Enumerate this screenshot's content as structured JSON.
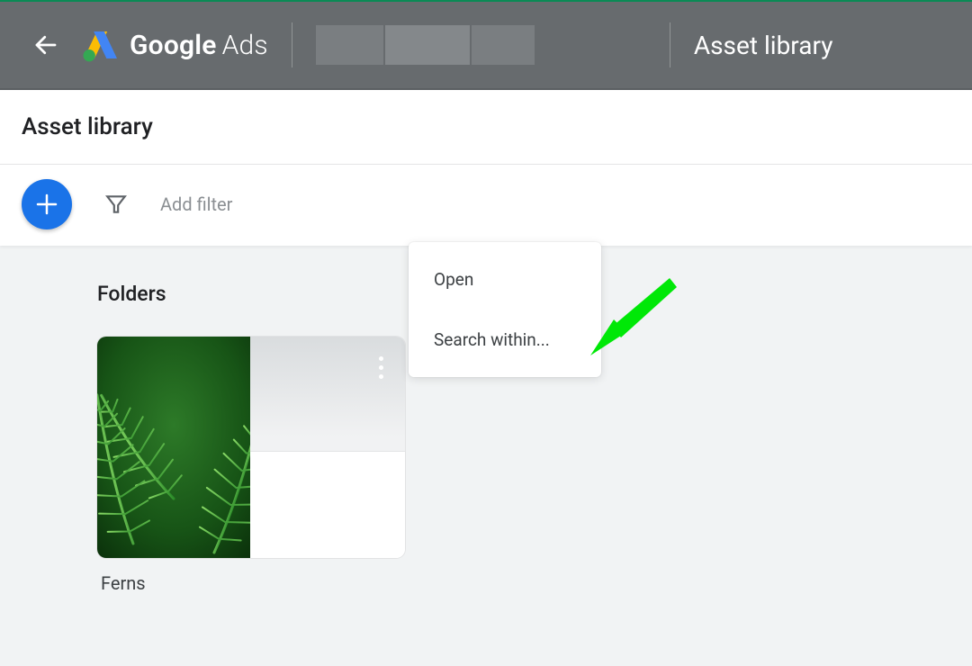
{
  "header": {
    "brand_bold": "Google",
    "brand_light": "Ads",
    "page_title": "Asset library"
  },
  "subheader": {
    "title": "Asset library"
  },
  "toolbar": {
    "filter_placeholder": "Add filter"
  },
  "folders": {
    "section_title": "Folders",
    "items": [
      {
        "name": "Ferns"
      }
    ]
  },
  "context_menu": {
    "items": [
      {
        "label": "Open"
      },
      {
        "label": "Search within..."
      }
    ]
  },
  "colors": {
    "accent": "#1a73e8",
    "header_bg": "#676b6e",
    "annotation_arrow": "#00e807"
  }
}
